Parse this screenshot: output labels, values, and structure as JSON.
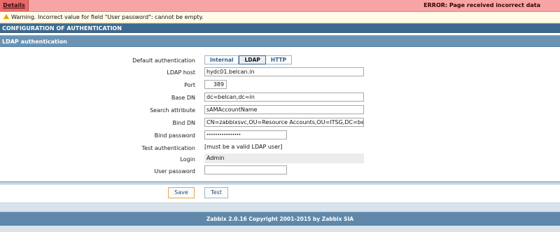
{
  "error_bar": {
    "details_label": "Details",
    "error_message": "ERROR: Page received incorrect data"
  },
  "warning": {
    "message": "Warning. Incorrect value for field \"User password\": cannot be empty."
  },
  "section": {
    "title": "CONFIGURATION OF AUTHENTICATION",
    "subtitle": "LDAP authentication"
  },
  "form": {
    "default_auth": {
      "label": "Default authentication",
      "options": [
        "Internal",
        "LDAP",
        "HTTP"
      ],
      "selected": "LDAP"
    },
    "ldap_host": {
      "label": "LDAP host",
      "value": "hydc01.belcan.in"
    },
    "port": {
      "label": "Port",
      "value": "389"
    },
    "base_dn": {
      "label": "Base DN",
      "value": "dc=belcan,dc=in"
    },
    "search_attribute": {
      "label": "Search attribute",
      "value": "sAMAccountName"
    },
    "bind_dn": {
      "label": "Bind DN",
      "value": "CN=zabbixsvc,OU=Resource Accounts,OU=ITSG,DC=belcan,DC=in"
    },
    "bind_password": {
      "label": "Bind password",
      "value": "••••••••••••••••"
    },
    "test_authentication": {
      "label": "Test authentication",
      "value": "[must be a valid LDAP user]"
    },
    "login": {
      "label": "Login",
      "value": "Admin"
    },
    "user_password": {
      "label": "User password",
      "value": ""
    }
  },
  "actions": {
    "save_label": "Save",
    "test_label": "Test"
  },
  "footer": {
    "copyright": "Zabbix 2.0.16 Copyright 2001-2015 by Zabbix SIA"
  },
  "colors": {
    "error_bg": "#f7a4a4",
    "details_bg": "#e86a6a",
    "header_dark": "#3d6a91",
    "header_light": "#6b93b4",
    "save_border": "#e2a84c"
  }
}
